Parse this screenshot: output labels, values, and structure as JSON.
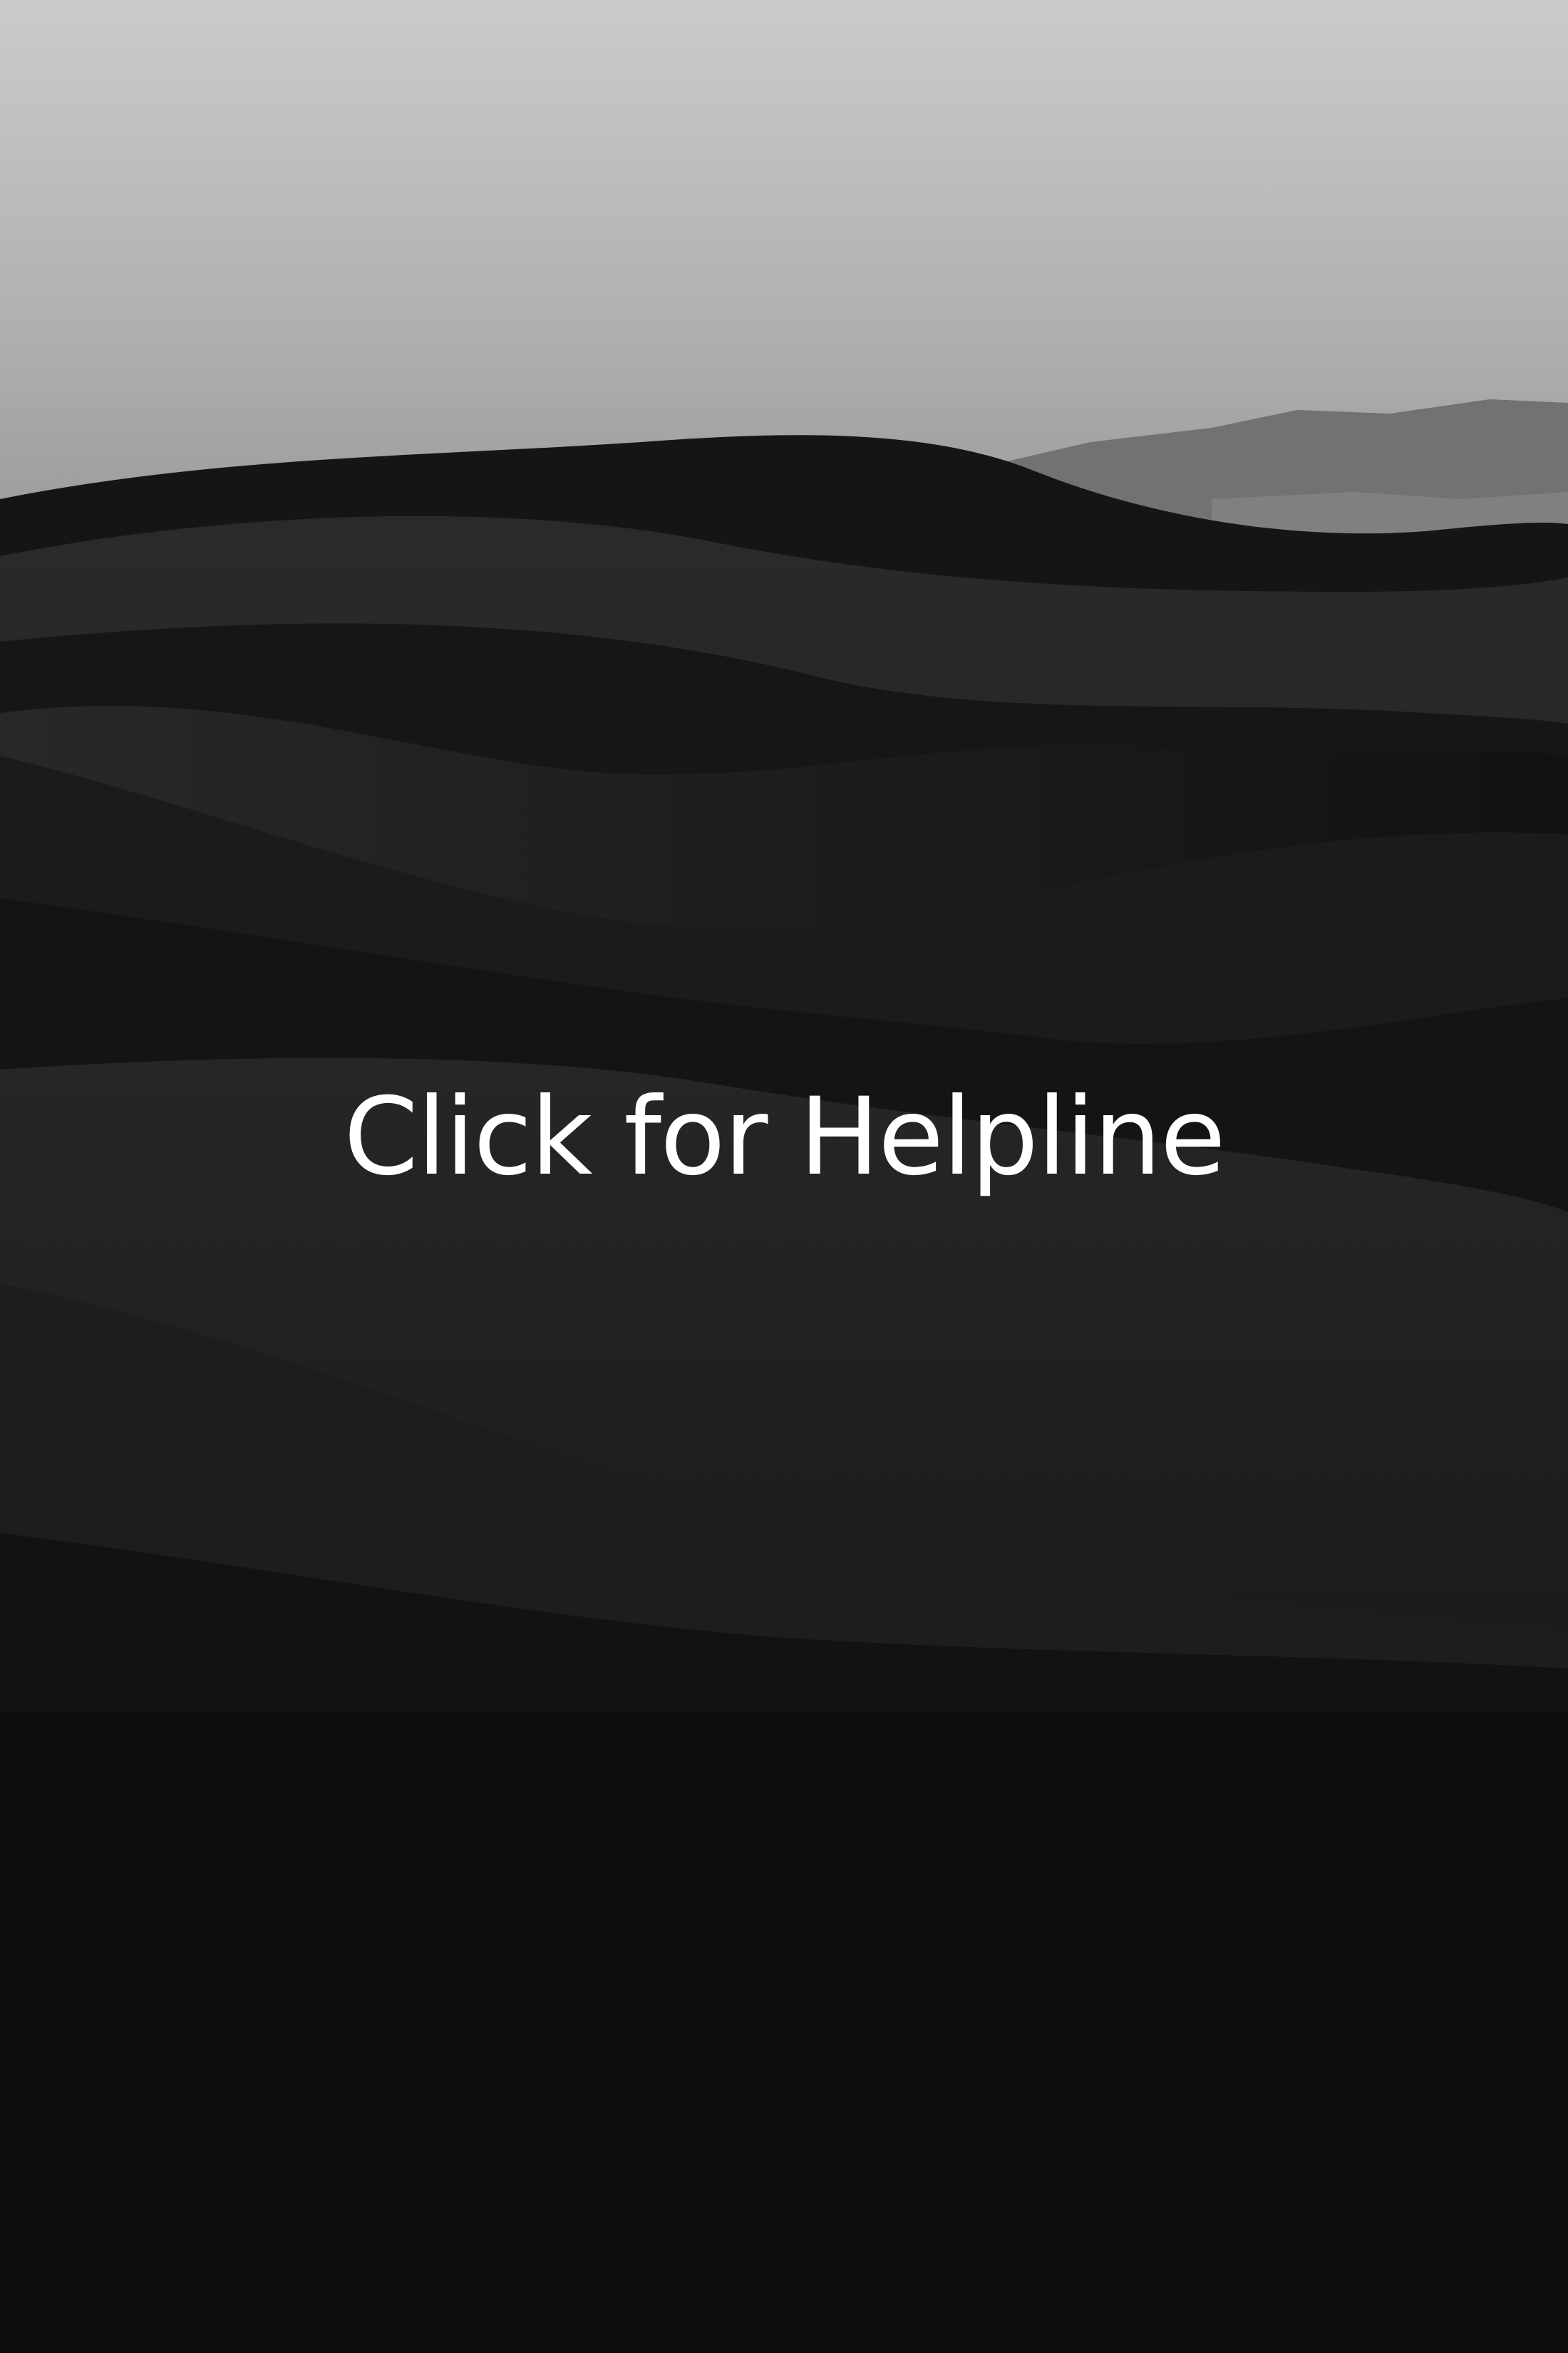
{
  "background": {
    "scene": "desert-dunes-photo",
    "colors": {
      "sky_top": "#c9c9c9",
      "sky_bottom": "#9e9e9e",
      "mountain": "#6f6f6f",
      "dune_dark": "#0d0d0d",
      "dune_mid": "#1a1a1a",
      "dune_light": "#262626"
    }
  },
  "cta": {
    "label": "Click for Helpline",
    "color": "#ffffff"
  }
}
